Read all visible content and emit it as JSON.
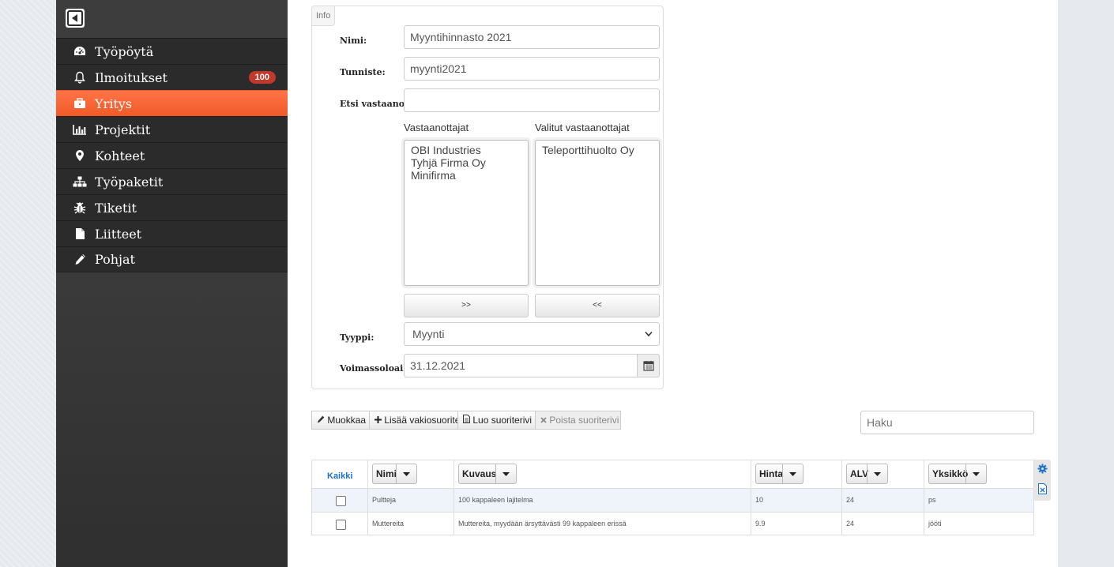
{
  "sidebar": {
    "items": [
      {
        "label": "Työpöytä",
        "icon": "dashboard-icon"
      },
      {
        "label": "Ilmoitukset",
        "icon": "bell-icon",
        "badge": "100"
      },
      {
        "label": "Yritys",
        "icon": "briefcase-icon",
        "active": true
      },
      {
        "label": "Projektit",
        "icon": "bar-chart-icon"
      },
      {
        "label": "Kohteet",
        "icon": "map-marker-icon"
      },
      {
        "label": "Työpaketit",
        "icon": "sitemap-icon"
      },
      {
        "label": "Tiketit",
        "icon": "bug-icon"
      },
      {
        "label": "Liitteet",
        "icon": "file-icon"
      },
      {
        "label": "Pohjat",
        "icon": "pencil-icon"
      }
    ],
    "accent": "#f05a28"
  },
  "info": {
    "legend": "Info",
    "name_label": "Nimi:",
    "name_value": "Myyntihinnasto 2021",
    "id_label": "Tunniste:",
    "id_value": "myynti2021",
    "search_label": "Etsi vastaanottajia",
    "search_value": "",
    "recipients_label": "Vastaanottajat",
    "selected_label": "Valitut vastaanottajat",
    "recipients": [
      "OBI Industries",
      "Tyhjä Firma Oy",
      "Minifirma"
    ],
    "selected": [
      "Teleporttihuolto Oy"
    ],
    "add_btn": ">>",
    "remove_btn": "<<",
    "type_label": "Tyyppi:",
    "type_value": "Myynti",
    "validity_label": "Voimassoloaika:",
    "validity_value": "31.12.2021"
  },
  "toolbar": {
    "edit": "Muokkaa",
    "add_default": "Lisää vakiosuorite",
    "create_row": "Luo suoriterivi",
    "delete_row": "Poista suoriterivi",
    "search_placeholder": "Haku"
  },
  "grid": {
    "select_all": "Kaikki",
    "columns": [
      "Nimi",
      "Kuvaus",
      "Hinta",
      "ALV",
      "Yksikkö"
    ],
    "rows": [
      {
        "name": "Pultteja",
        "desc": "100 kappaleen lajitelma",
        "price": "10",
        "vat": "24",
        "unit": "ps"
      },
      {
        "name": "Muttereita",
        "desc": "Muttereita, myydään ärsyttävästi 99 kappaleen erissä",
        "price": "9.9",
        "vat": "24",
        "unit": "jööti"
      }
    ]
  }
}
